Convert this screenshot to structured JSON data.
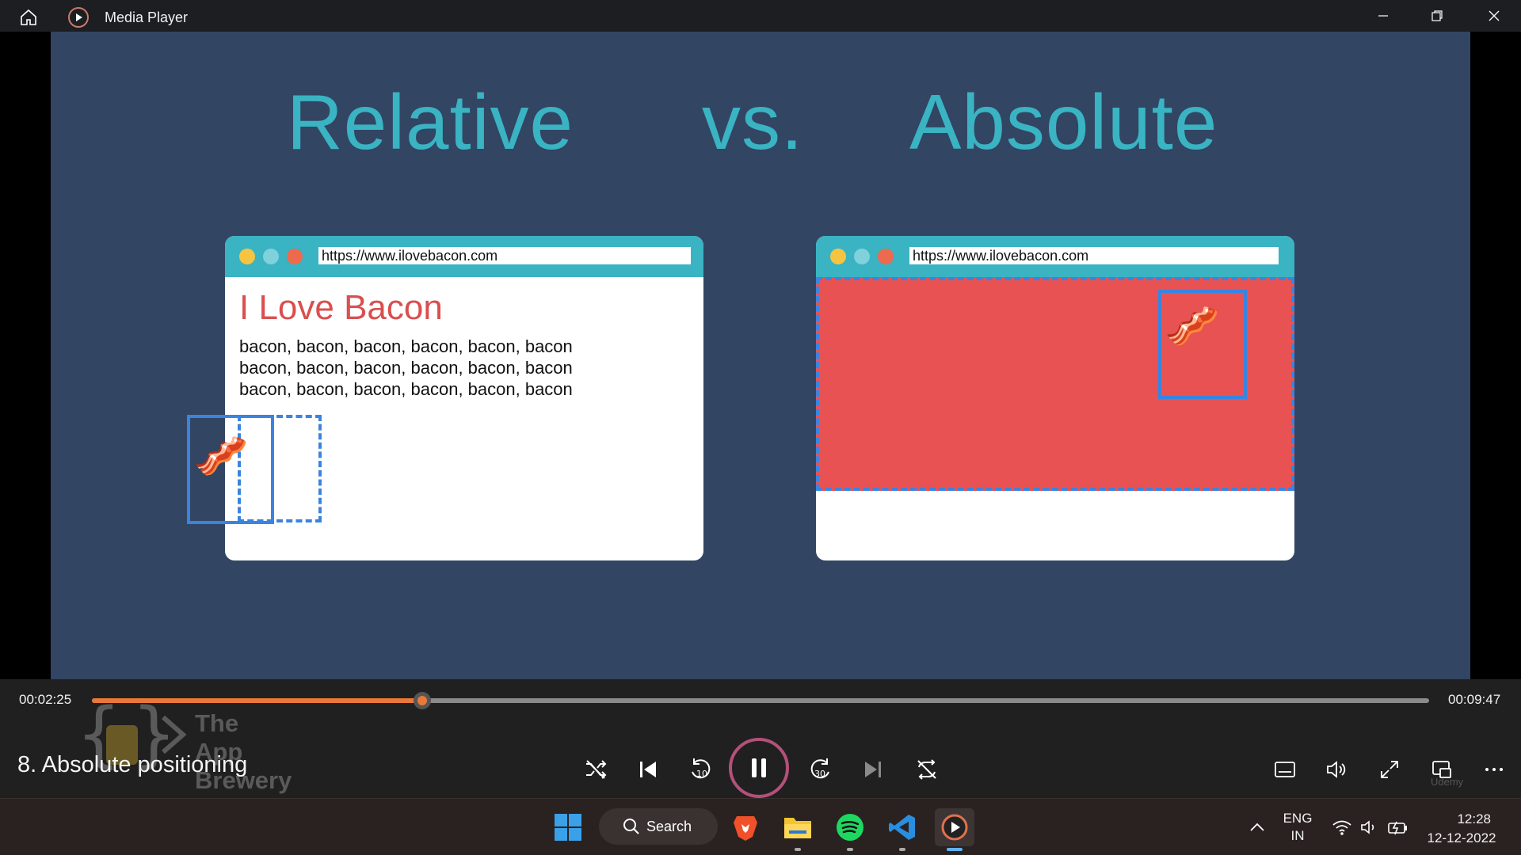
{
  "window": {
    "title": "Media Player"
  },
  "slide": {
    "title_left": "Relative",
    "title_mid": "vs.",
    "title_right": "Absolute",
    "left_browser": {
      "url": "https://www.ilovebacon.com",
      "heading": "I Love Bacon",
      "lines": [
        "bacon, bacon, bacon, bacon, bacon, bacon",
        "bacon, bacon, bacon, bacon, bacon, bacon",
        "bacon, bacon, bacon, bacon, bacon, bacon"
      ]
    },
    "right_browser": {
      "url": "https://www.ilovebacon.com"
    },
    "colors": {
      "background": "#324563",
      "title": "#3ab3c2",
      "browser_bar": "#3ab3c2",
      "heading": "#d94f4f",
      "red_block": "#e85252",
      "outline_blue": "#3a84e0"
    }
  },
  "player": {
    "elapsed": "00:02:25",
    "total": "00:09:47",
    "progress_fraction": 0.247,
    "episode_title": "8. Absolute positioning",
    "watermark_line1": "The",
    "watermark_line2": "App Brewery",
    "corner_watermark": "Udemy",
    "accent_color": "#e8793a"
  },
  "taskbar": {
    "search_label": "Search",
    "lang_top": "ENG",
    "lang_bottom": "IN",
    "time": "12:28",
    "date": "12-12-2022"
  }
}
